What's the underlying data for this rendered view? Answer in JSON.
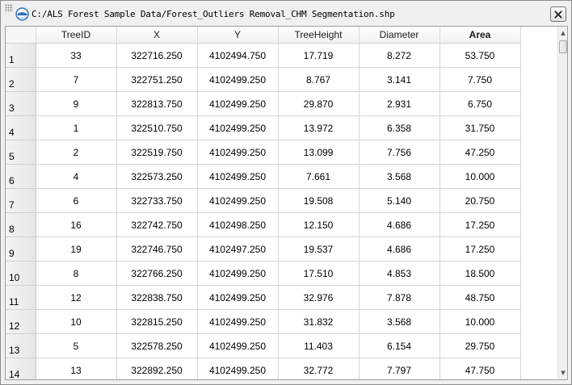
{
  "window": {
    "title": "C:/ALS Forest Sample Data/Forest_Outliers Removal_CHM Segmentation.shp",
    "close_icon": "close-icon",
    "app_icon": "lidar360-app-icon"
  },
  "table": {
    "columns": [
      "TreeID",
      "X",
      "Y",
      "TreeHeight",
      "Diameter",
      "Area"
    ],
    "rows": [
      {
        "n": "1",
        "cells": [
          "33",
          "322716.250",
          "4102494.750",
          "17.719",
          "8.272",
          "53.750"
        ]
      },
      {
        "n": "2",
        "cells": [
          "7",
          "322751.250",
          "4102499.250",
          "8.767",
          "3.141",
          "7.750"
        ]
      },
      {
        "n": "3",
        "cells": [
          "9",
          "322813.750",
          "4102499.250",
          "29.870",
          "2.931",
          "6.750"
        ]
      },
      {
        "n": "4",
        "cells": [
          "1",
          "322510.750",
          "4102499.250",
          "13.972",
          "6.358",
          "31.750"
        ]
      },
      {
        "n": "5",
        "cells": [
          "2",
          "322519.750",
          "4102499.250",
          "13.099",
          "7.756",
          "47.250"
        ]
      },
      {
        "n": "6",
        "cells": [
          "4",
          "322573.250",
          "4102499.250",
          "7.661",
          "3.568",
          "10.000"
        ]
      },
      {
        "n": "7",
        "cells": [
          "6",
          "322733.750",
          "4102499.250",
          "19.508",
          "5.140",
          "20.750"
        ]
      },
      {
        "n": "8",
        "cells": [
          "16",
          "322742.750",
          "4102498.250",
          "12.150",
          "4.686",
          "17.250"
        ]
      },
      {
        "n": "9",
        "cells": [
          "19",
          "322746.750",
          "4102497.250",
          "19.537",
          "4.686",
          "17.250"
        ]
      },
      {
        "n": "10",
        "cells": [
          "8",
          "322766.250",
          "4102499.250",
          "17.510",
          "4.853",
          "18.500"
        ]
      },
      {
        "n": "11",
        "cells": [
          "12",
          "322838.750",
          "4102499.250",
          "32.976",
          "7.878",
          "48.750"
        ]
      },
      {
        "n": "12",
        "cells": [
          "10",
          "322815.250",
          "4102499.250",
          "31.832",
          "3.568",
          "10.000"
        ]
      },
      {
        "n": "13",
        "cells": [
          "5",
          "322578.250",
          "4102499.250",
          "11.403",
          "6.154",
          "29.750"
        ]
      },
      {
        "n": "14",
        "cells": [
          "13",
          "322892.250",
          "4102499.250",
          "32.772",
          "7.797",
          "47.750"
        ]
      }
    ]
  },
  "scrollbar": {
    "up_arrow": "▲",
    "down_arrow": "▼"
  }
}
